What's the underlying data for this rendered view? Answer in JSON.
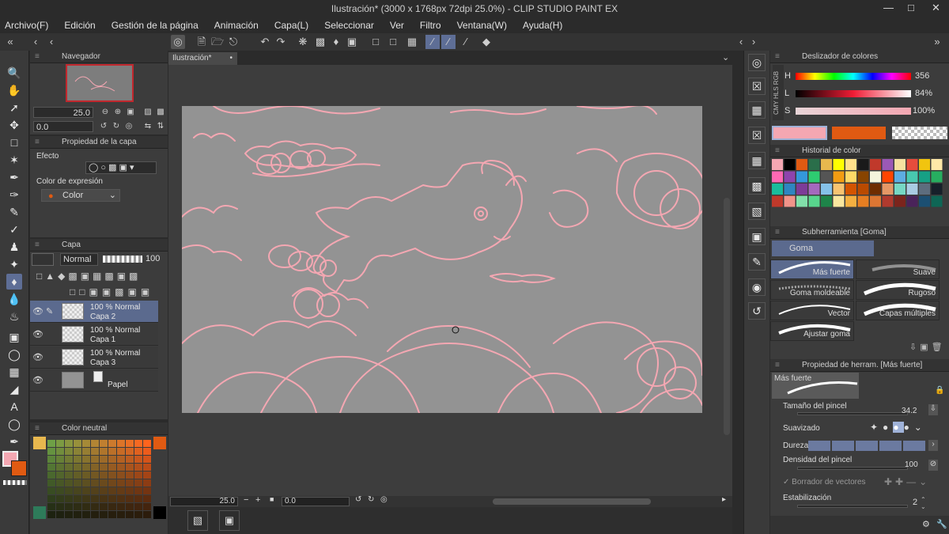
{
  "window": {
    "title": "Ilustración* (3000 x 1768px 72dpi 25.0%) - CLIP STUDIO PAINT EX"
  },
  "menu": [
    "Archivo(F)",
    "Edición",
    "Gestión de la página",
    "Animación",
    "Capa(L)",
    "Seleccionar",
    "Ver",
    "Filtro",
    "Ventana(W)",
    "Ayuda(H)"
  ],
  "navigator": {
    "title": "Navegador",
    "zoom": "25.0",
    "angle": "0.0"
  },
  "layer_property": {
    "title": "Propiedad de la capa",
    "effect_label": "Efecto",
    "expression_label": "Color de expresión",
    "expression_value": "Color"
  },
  "layers": {
    "title": "Capa",
    "blend_mode": "Normal",
    "opacity": "100",
    "items": [
      {
        "mode": "100 % Normal",
        "name": "Capa 2"
      },
      {
        "mode": "100 % Normal",
        "name": "Capa 1"
      },
      {
        "mode": "100 % Normal",
        "name": "Capa 3"
      },
      {
        "mode": "",
        "name": "Papel"
      }
    ]
  },
  "color_set": {
    "title": "Color neutral"
  },
  "document": {
    "tab": "Ilustración*",
    "zoom": "25.0",
    "angle": "0.0"
  },
  "color_slider": {
    "title": "Deslizador de colores",
    "h_label": "H",
    "h_value": "356",
    "l_label": "L",
    "l_value": "84%",
    "s_label": "S",
    "s_value": "100%",
    "modes": [
      "RGB",
      "HLS",
      "CMY"
    ]
  },
  "color_history": {
    "title": "Historial de color"
  },
  "subtool": {
    "title": "Subherramienta [Goma]",
    "group": "Goma",
    "brushes": [
      "Más fuerte",
      "Suave",
      "Goma moldeable",
      "Rugoso",
      "Vector",
      "Capas múltiples",
      "Ajustar goma"
    ]
  },
  "tool_property": {
    "title": "Propiedad de herram. [Más fuerte]",
    "preset": "Más fuerte",
    "brush_size_label": "Tamaño del pincel",
    "brush_size_value": "34.2",
    "smoothing_label": "Suavizado",
    "hardness_label": "Dureza",
    "density_label": "Densidad del pincel",
    "density_value": "100",
    "vector_eraser_label": "Borrador de vectores",
    "stabilization_label": "Estabilización",
    "stabilization_value": "2"
  },
  "colors": {
    "main_color": "#f4a7b2",
    "sub_color": "#e05a12",
    "selection": "#5b6a8e",
    "canvas": "#939393",
    "sketch": "#f4a7b2"
  }
}
